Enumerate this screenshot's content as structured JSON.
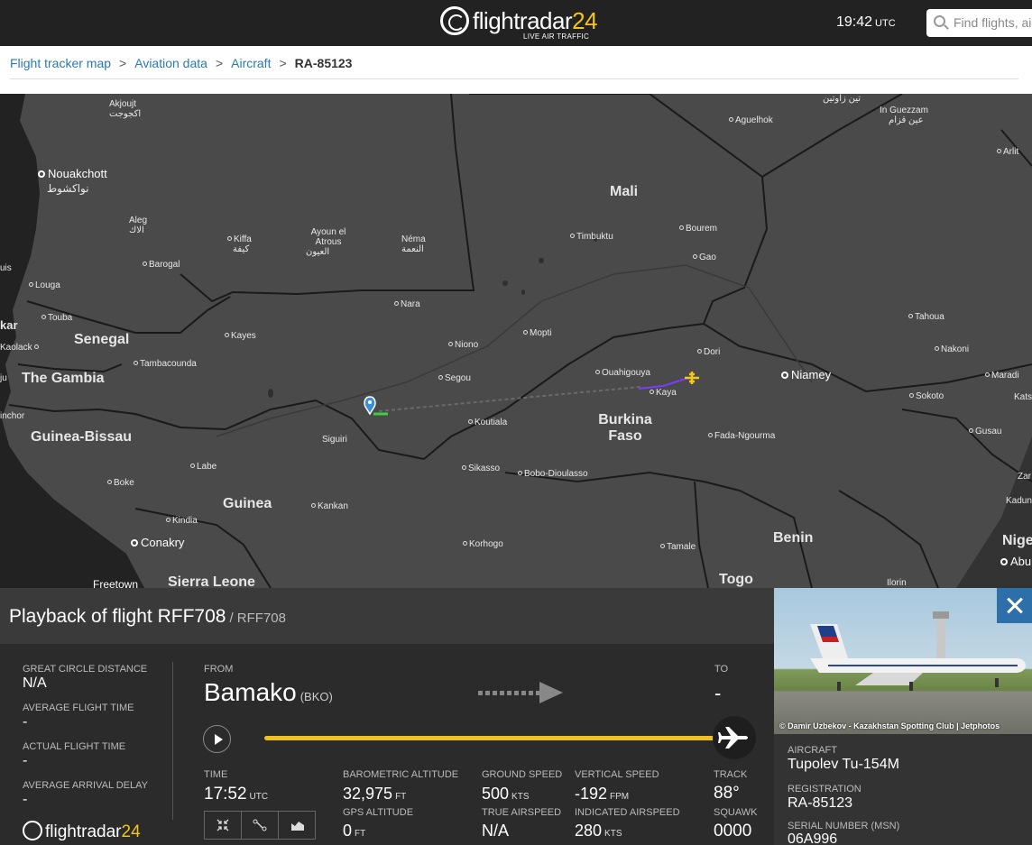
{
  "header": {
    "logo_text": "flightradar",
    "logo_num": "24",
    "logo_sub": "LIVE AIR TRAFFIC",
    "time": "19:42",
    "time_zone": "UTC",
    "search_placeholder": "Find flights, airports"
  },
  "breadcrumb": {
    "items": [
      "Flight tracker map",
      "Aviation data",
      "Aircraft"
    ],
    "current": "RA-85123",
    "separator": ">"
  },
  "map": {
    "countries": [
      "Mali",
      "Senegal",
      "The Gambia",
      "Guinea-Bissau",
      "Guinea",
      "Sierra Leone",
      "Burkina Faso",
      "Benin",
      "Togo",
      "Nige"
    ],
    "capitals": [
      "Nouakchott",
      "Niamey",
      "Conakry",
      "Abu"
    ],
    "cities": [
      "Akjoujt",
      "Aleg",
      "Kiffa",
      "Ayoun el Atrous",
      "Néma",
      "Barogal",
      "Louga",
      "Touba",
      "Kaolack",
      "Kayes",
      "Tambacounda",
      "Nara",
      "Niono",
      "Segou",
      "Mopti",
      "Timbuktu",
      "Bourem",
      "Gao",
      "Aguelhok",
      "In Guezzam",
      "Arlit",
      "Tahoua",
      "Nakoni",
      "Maradi",
      "Dori",
      "Ouahigouya",
      "Kaya",
      "Koutiala",
      "Sikasso",
      "Bobo-Dioulasso",
      "Fada-Ngourma",
      "Sokoto",
      "Gusau",
      "Labe",
      "Boke",
      "Kindia",
      "Siguiri",
      "Kankan",
      "Korhogo",
      "Tamale",
      "Ilorin",
      "Freetown",
      "Bamako",
      "Kats",
      "Zar",
      "Kadun",
      "uis",
      "kar",
      "ju",
      "inchor",
      "Tin Zaouatine"
    ],
    "cities_ar": {
      "Akjoujt": "اكجوجت",
      "Nouakchott": "نواكشوط",
      "Aleg": "الاك",
      "Kiffa": "كيفة",
      "Ayoun": "العيون",
      "Nema": "النعمة",
      "Tin": "تين زاوتين",
      "InGuezzam": "عين قزام"
    },
    "route_color": "#7a3cff",
    "track_color": "#555"
  },
  "panel": {
    "title": "Playback of flight RFF708",
    "title_sub": "/ RFF708",
    "stats_left": [
      {
        "label": "GREAT CIRCLE DISTANCE",
        "value": "N/A"
      },
      {
        "label": "AVERAGE FLIGHT TIME",
        "value": "-"
      },
      {
        "label": "ACTUAL FLIGHT TIME",
        "value": "-"
      },
      {
        "label": "AVERAGE ARRIVAL DELAY",
        "value": "-"
      }
    ],
    "from_label": "FROM",
    "from_city": "Bamako",
    "from_code": "(BKO)",
    "to_label": "TO",
    "to_city": "-",
    "progress": 1.0,
    "time_label": "TIME",
    "time_value": "17:52",
    "time_unit": "UTC",
    "baro_label": "BAROMETRIC ALTITUDE",
    "baro_value": "32,975",
    "baro_unit": "FT",
    "gps_label": "GPS ALTITUDE",
    "gps_value": "0",
    "gps_unit": "FT",
    "gs_label": "GROUND SPEED",
    "gs_value": "500",
    "gs_unit": "KTS",
    "tas_label": "TRUE AIRSPEED",
    "tas_value": "N/A",
    "vs_label": "VERTICAL SPEED",
    "vs_value": "-192",
    "vs_unit": "FPM",
    "ias_label": "INDICATED AIRSPEED",
    "ias_value": "280",
    "ias_unit": "KTS",
    "track_label": "TRACK",
    "track_value": "88°",
    "squawk_label": "SQUAWK",
    "squawk_value": "0000",
    "footer_logo": "flightradar",
    "footer_logo_num": "24",
    "accent": "#f0c020"
  },
  "side": {
    "photo_credit": "© Damir Uzbekov - Kazakhstan Spotting Club | Jetphotos",
    "aircraft_label": "AIRCRAFT",
    "aircraft_value": "Tupolev Tu-154M",
    "registration_label": "REGISTRATION",
    "registration_value": "RA-85123",
    "serial_label": "SERIAL NUMBER (MSN)",
    "serial_value": "06A996"
  }
}
